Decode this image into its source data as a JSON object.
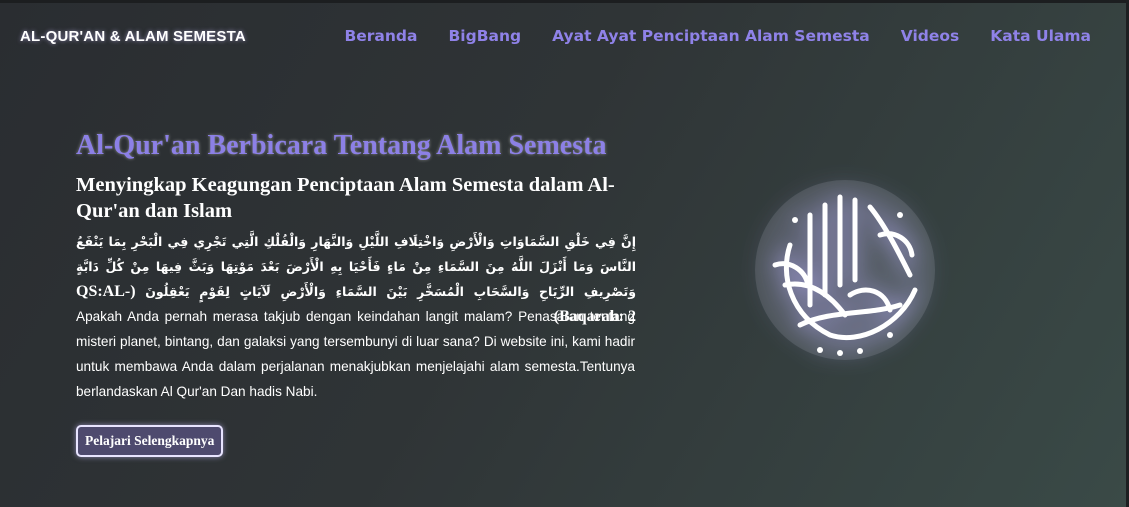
{
  "nav": {
    "brand": "AL-QUR'AN & ALAM SEMESTA",
    "links": [
      "Beranda",
      "BigBang",
      "Ayat Ayat Penciptaan Alam Semesta",
      "Videos",
      "Kata Ulama"
    ]
  },
  "hero": {
    "title": "Al-Qur'an Berbicara Tentang Alam Semesta",
    "subtitle": "Menyingkap Keagungan Penciptaan Alam Semesta dalam Al-Qur'an dan Islam",
    "ayat": "إِنَّ فِي خَلْقِ السَّمَاوَاتِ وَالْأَرْضِ وَاخْتِلَافِ اللَّيْلِ وَالنَّهَارِ وَالْفُلْكِ الَّتِي تَجْرِي فِي الْبَحْرِ بِمَا يَنْفَعُ النَّاسَ وَمَا أَنْزَلَ اللَّهُ مِنَ السَّمَاءِ مِنْ مَاءٍ فَأَحْيَا بِهِ الْأَرْضَ بَعْدَ مَوْتِهَا وَبَثَّ فِيهَا مِنْ كُلِّ دَابَّةٍ وَتَصْرِيفِ الرِّيَاحِ وَالسَّحَابِ الْمُسَخَّرِ بَيْنَ السَّمَاءِ وَالْأَرْضِ لَآيَاتٍ لِقَوْمٍ يَعْقِلُونَ",
    "ayat_ref": "(QS:AL-Baqarah: 2)",
    "description": "Apakah Anda pernah merasa takjub dengan keindahan langit malam? Penasaran tentang misteri planet, bintang, dan galaksi yang tersembunyi di luar sana? Di website ini, kami hadir untuk membawa Anda dalam perjalanan menakjubkan menjelajahi alam semesta.Tentunya berlandaskan Al Qur'an Dan hadis Nabi.",
    "button": "Pelajari Selengkapnya"
  },
  "image": {
    "icon": "arabic-calligraphy-emblem"
  },
  "colors": {
    "accent": "#8c80e6",
    "button_bg": "#4e4a6e"
  }
}
